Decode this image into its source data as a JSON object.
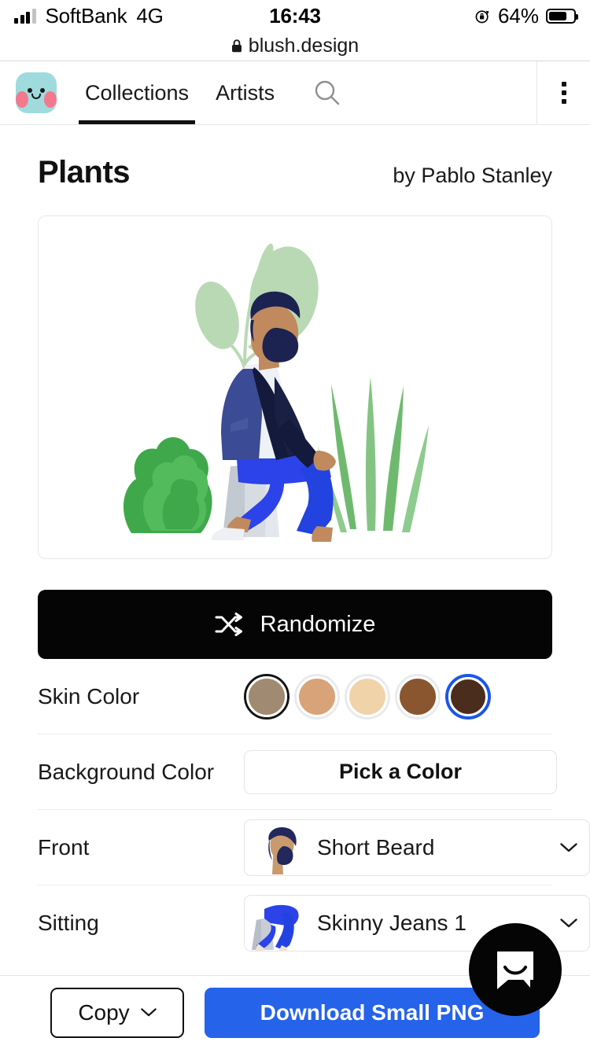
{
  "status_bar": {
    "carrier": "SoftBank",
    "network": "4G",
    "time": "16:43",
    "battery_percent": "64%",
    "battery_level": 64,
    "signal_icon": "signal-bars-icon",
    "rotation_lock_icon": "rotation-lock-icon",
    "battery_icon": "battery-icon"
  },
  "browser": {
    "lock_icon": "lock-icon",
    "host": "blush.design"
  },
  "nav": {
    "logo_icon": "blush-logo-icon",
    "tabs": [
      {
        "label": "Collections",
        "active": true
      },
      {
        "label": "Artists",
        "active": false
      }
    ],
    "search_icon": "search-icon",
    "menu_icon": "kebab-menu-icon"
  },
  "collection": {
    "title": "Plants",
    "author": "by Pablo Stanley"
  },
  "illustration": {
    "name": "man-sitting-with-plants-illustration",
    "colors": {
      "leaf_light": "#b9d9b4",
      "leaf_mid": "#8fc98a",
      "leaf_dark": "#3fa84a",
      "leaf_darker": "#2f8f3d",
      "jacket": "#3b428f",
      "jacket_dark": "#141a3c",
      "shirt": "#f0f2f7",
      "jeans": "#2b43e8",
      "skin": "#c08a5e",
      "hair": "#1d2350",
      "block": "#c9ced6",
      "block_light": "#dde1e7",
      "shoe": "#eef0f3"
    }
  },
  "randomize": {
    "icon": "shuffle-icon",
    "label": "Randomize",
    "background": "#050505"
  },
  "options": [
    {
      "label": "Skin Color",
      "type": "swatches",
      "swatches": [
        {
          "name": "skin-swatch-1",
          "color": "#a08a72",
          "state": "hovered"
        },
        {
          "name": "skin-swatch-2",
          "color": "#d8a379",
          "state": "default"
        },
        {
          "name": "skin-swatch-3",
          "color": "#f0d3a9",
          "state": "default"
        },
        {
          "name": "skin-swatch-4",
          "color": "#8a5630",
          "state": "default"
        },
        {
          "name": "skin-swatch-5",
          "color": "#4a2d1c",
          "state": "selected"
        }
      ],
      "selected_color": "#4a2d1c",
      "selected_ring": "#1a56e8"
    },
    {
      "label": "Background Color",
      "type": "button",
      "button_label": "Pick a Color"
    },
    {
      "label": "Front",
      "type": "dropdown",
      "value": "Short Beard",
      "thumb": "short-beard-thumbnail",
      "chevron_icon": "chevron-down-icon"
    },
    {
      "label": "Sitting",
      "type": "dropdown",
      "value": "Skinny Jeans 1",
      "thumb": "skinny-jeans-thumbnail",
      "chevron_icon": "chevron-down-icon"
    }
  ],
  "intercom": {
    "icon": "intercom-chat-icon",
    "background": "#050505"
  },
  "bottom_bar": {
    "copy_label": "Copy",
    "copy_chevron_icon": "chevron-down-icon",
    "download_label": "Download Small PNG",
    "download_color": "#2563eb"
  }
}
